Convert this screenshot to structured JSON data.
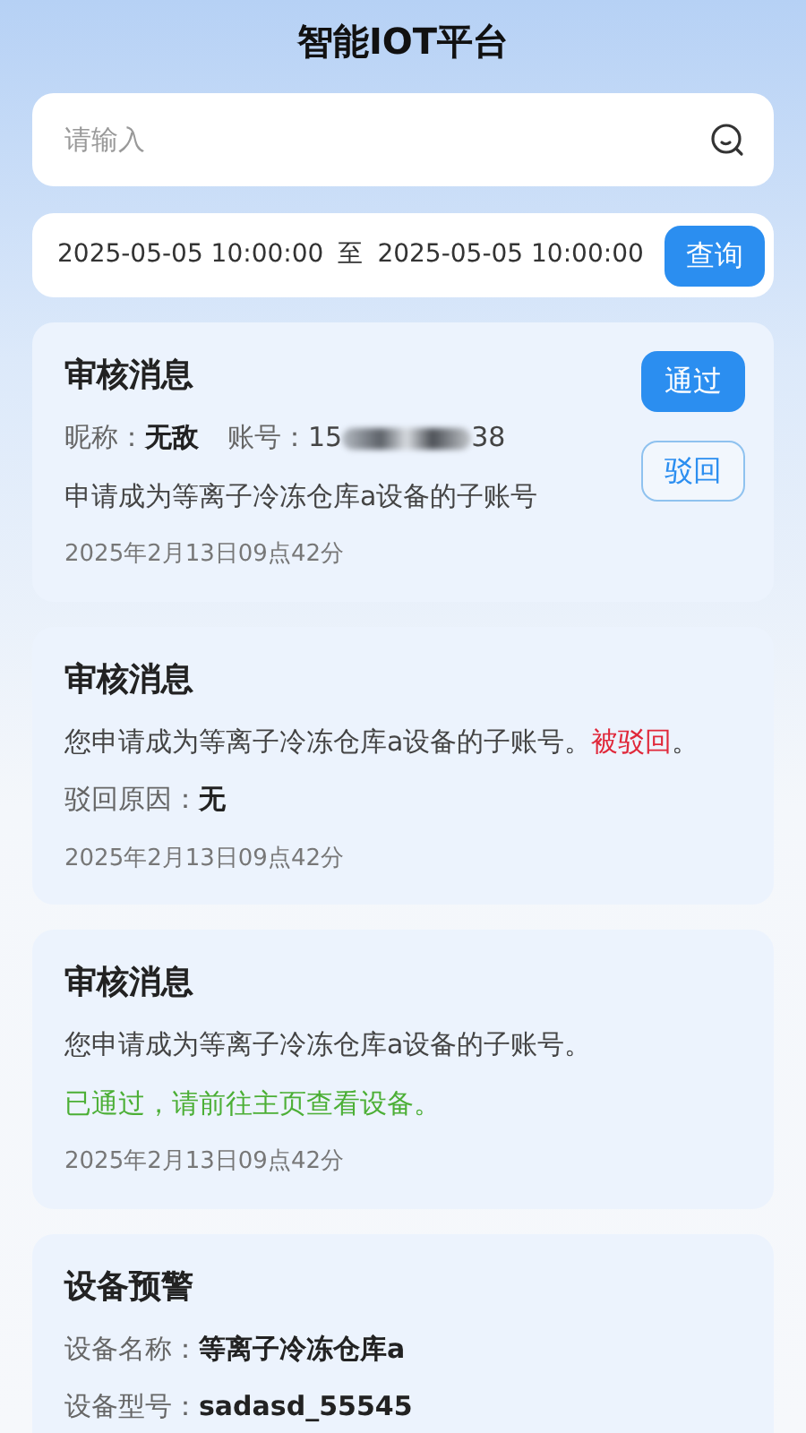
{
  "header": {
    "title": "智能IOT平台"
  },
  "search": {
    "placeholder": "请输入"
  },
  "date_filter": {
    "start": "2025-05-05 10:00:00",
    "separator": "至",
    "end": "2025-05-05 10:00:00",
    "button": "查询"
  },
  "cards": [
    {
      "kind": "review_request",
      "title": "审核消息",
      "nickname_label": "昵称：",
      "nickname": "无敌",
      "account_label": "账号：",
      "account_prefix": "15",
      "account_suffix": "38",
      "message": "申请成为等离子冷冻仓库a设备的子账号",
      "time": "2025年2月13日09点42分",
      "approve_button": "通过",
      "reject_button": "驳回"
    },
    {
      "kind": "rejected",
      "title": "审核消息",
      "message": "您申请成为等离子冷冻仓库a设备的子账号。",
      "status": "被驳回",
      "status_end": "。",
      "reason_label": "驳回原因：",
      "reason": "无",
      "time": "2025年2月13日09点42分"
    },
    {
      "kind": "approved",
      "title": "审核消息",
      "message": "您申请成为等离子冷冻仓库a设备的子账号。",
      "status": "已通过，请前往主页查看设备。",
      "time": "2025年2月13日09点42分"
    },
    {
      "kind": "device_alert",
      "title": "设备预警",
      "fields": [
        {
          "label": "设备名称：",
          "value": "等离子冷冻仓库a"
        },
        {
          "label": "设备型号：",
          "value": "sadasd_55545"
        }
      ]
    }
  ]
}
